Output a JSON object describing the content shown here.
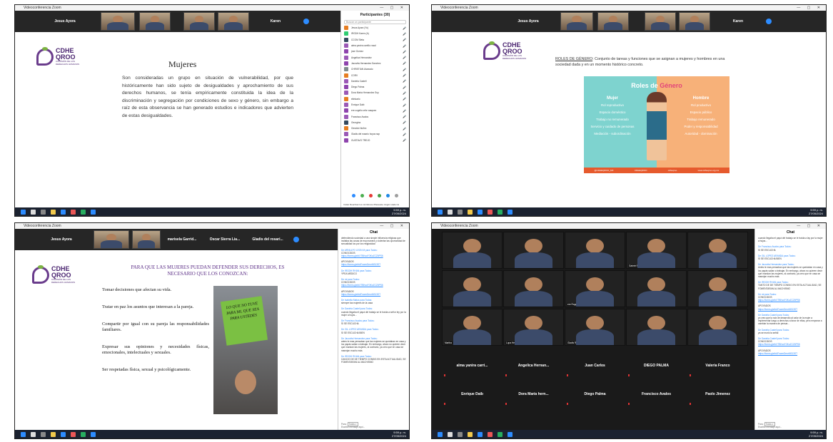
{
  "app": {
    "window_title": "Videoconferencia Zoom",
    "taskbar_clock": {
      "time": "9:59 p. m.",
      "date": "27/05/2024"
    }
  },
  "logo": {
    "name1": "CDHE",
    "name2": "QROO",
    "sub1": "COMISIÓN DE LOS",
    "sub2": "DERECHOS HUMANOS",
    "sub3": "DEL ESTADO DE QUINTANA ROO"
  },
  "screen1": {
    "strip_names": [
      "Jesus Ayora",
      "Karen"
    ],
    "slide_title": "Mujeres",
    "slide_body": "Son consideradas un grupo en situación de vulnerabilidad, por que históricamente han sido sujeto de desigualdades y aprochamiento de sus derechos humanos, se tenía empíricamente constituida la idea de la discriminación y segregación por condiciones de sexo y género, sin embargo a raíz de esta observancia se han generado estudios e indicadores que advierten de estas desigualdades.",
    "panel_title": "Participantes (30)",
    "search_placeholder": "Buscar un participante",
    "participants": [
      {
        "name": "Jesus Ayora (Yo)",
        "color": "#e67e22"
      },
      {
        "name": "IRGDH Karen (A)",
        "color": "#2ecc71"
      },
      {
        "name": "CCOM Sleta",
        "color": "#34495e"
      },
      {
        "name": "alma yanira carrillo rosal",
        "color": "#9b59b6"
      },
      {
        "name": "jose Gomez",
        "color": "#8e44ad"
      },
      {
        "name": "Angelica Hernandez",
        "color": "#9b59b6"
      },
      {
        "name": "Jacovita Hernandez Sanchez",
        "color": "#8e44ad"
      },
      {
        "name": "CHRISTIAN Alvarado",
        "color": "#7f8c8d"
      },
      {
        "name": "CORV",
        "color": "#e67e22"
      },
      {
        "name": "Daniela Castell",
        "color": "#9b59b6"
      },
      {
        "name": "Diego Palma",
        "color": "#8e44ad"
      },
      {
        "name": "Dora Maria Hernandez Ssp",
        "color": "#9b59b6"
      },
      {
        "name": "elielcarlo",
        "color": "#e67e22"
      },
      {
        "name": "Enrique Daib",
        "color": "#9b59b6"
      },
      {
        "name": "ere cogelio ortiz vasquez",
        "color": "#8e44ad"
      },
      {
        "name": "Francisco Avalos",
        "color": "#9b59b6"
      },
      {
        "name": "Georgina",
        "color": "#34495e"
      },
      {
        "name": "Geraldo Nuñez",
        "color": "#e67e22"
      },
      {
        "name": "Gladis del rosario hoyos ssp",
        "color": "#9b59b6"
      },
      {
        "name": "GUSTAVO TREJO",
        "color": "#8e44ad"
      }
    ],
    "panel_footer": "Invitar    Reactivar los micrófonos    Placeaste ningún viador ►"
  },
  "screen2": {
    "strip_names": [
      "Jesus Ayora",
      "Karen"
    ],
    "label": "ROLES DE GÉNERO",
    "definition": ": Conjunto de tareas y funciones que se asignan a mujeres y hombres en una sociedad dada y en un momento histórico concreto.",
    "infographic": {
      "title1": "Roles de",
      "title2": "Género",
      "mujer_head": "Mujer",
      "mujer_items": [
        "Rol reproductivo",
        "Espacio doméstico",
        "Trabajo no remunerado",
        "Servicio y cuidado de personas",
        "Mediación - subordinación"
      ],
      "hombre_head": "Hombre",
      "hombre_items": [
        "Rol productivo",
        "Espacio público",
        "Trabajo remunerado",
        "Poder y responsabilidad",
        "Autoridad - dominación"
      ],
      "footer": [
        "@CDHEQROO_MX",
        "CDHEQROO",
        "cdheqroo",
        "www.cdheqroo.org.mx"
      ]
    }
  },
  "screen3": {
    "strip_names": [
      "Jesus Ayora",
      "marisela Garrid...",
      "Oscar Sierra Lia...",
      "Gladis del rosari..."
    ],
    "heading": "PARA QUE LAS MUJERES PUEDAN DEFENDER SUS DERECHOS, ES NECESARIO QUE LOS CONOZCAN:",
    "items": [
      "Tomar decisiones que afectan su vida.",
      "Tratar en paz los asuntos que interesan a la pareja.",
      "Compartir por igual con su pareja las responsabilidades familiares.",
      "Expresar sus opiniones y necesidades físicas, emocionales, intelectuales y sexuales.",
      "Ser respetadas física, sexual y psicológicamente."
    ],
    "sign_text": "LO QUE NO TUVE PARA MI, QUE SEA PARA USTEDES",
    "chat_title": "Chat",
    "chat_messages": [
      {
        "from": "",
        "text": "defendiendo sociedad a una simple influencia religiosa que incitaba las cosas de esa manera y violentar las oportunidad de sexualidad los por los religiosidad"
      },
      {
        "from": "De ARNULFO LEON M para Todos:",
        "text": "CONOCIDOS",
        "link": "https://forms.gle/kXTBKsdY3KoZCZ6PS6"
      },
      {
        "from": "",
        "text": "APOYADOS",
        "link": "https://forms.gle/kAFnwmDenrMSJ3ST"
      },
      {
        "from": "De IRGDH RHAN para Todos:",
        "text": "YPEA MEDICO"
      },
      {
        "from": "De mi para Todos:",
        "text": "CONOCIDOS",
        "link": "https://forms.gle/kXTBKsdY3KoZCZ6PS6"
      },
      {
        "from": "",
        "text": "APOYADOS",
        "link": "https://forms.gle/kAFnwmDenrMSJ3ST"
      },
      {
        "from": "De Isabella Matus para Todos:",
        "text": "siempre las mujeres de la casa"
      },
      {
        "from": "De Daniela Castell para Todos:",
        "text": "cuando llegaba el papá del trabajo se le traída a señor ley por la mujer a hujos..."
      },
      {
        "from": "De Francisco Avalos para Todos:",
        "text": "SI SE ESCUCHA"
      },
      {
        "from": "De GIL LOPEZ ARANDA para Todos:",
        "text": "SI SE ESCUCHA BIEN"
      },
      {
        "from": "De Jacovita Hernandez para Todos:",
        "text": "antes te mas pensaban que las mujeres se quedaban en casa y los papás salían a trabajar. En embargo, ahora no quieren decir que mandan las mujeres, al contrario, ya creo que en casa se manejan mucho más"
      },
      {
        "from": "De IRGDH RHAN para Todos:",
        "text": "CANCIO DE DE TIEMPO CONSIG EN ESTA ACTUALIDAD, SE FOMENTARAN AL MACHISMO"
      }
    ],
    "chat_to_label": "Para:",
    "chat_to_value": "Todos ▾",
    "chat_input_placeholder": "Escribir mensaje aquí..."
  },
  "screen4": {
    "chat_title": "Chat",
    "tiles": [
      {
        "name": "",
        "row": 0,
        "col": 0
      },
      {
        "name": "",
        "row": 0,
        "col": 1
      },
      {
        "name": "",
        "row": 0,
        "col": 2
      },
      {
        "name": "Gabriel Nieto",
        "row": 0,
        "col": 3
      },
      {
        "name": "",
        "row": 0,
        "col": 4
      },
      {
        "name": "",
        "row": 1,
        "col": 0
      },
      {
        "name": "",
        "row": 1,
        "col": 1
      },
      {
        "name": "ere Rogelio ortiz vásquez",
        "row": 1,
        "col": 2
      },
      {
        "name": "",
        "row": 1,
        "col": 3
      },
      {
        "name": "",
        "row": 1,
        "col": 4
      },
      {
        "name": "Martha",
        "row": 2,
        "col": 0
      },
      {
        "name": "Lupa Hernandez",
        "row": 2,
        "col": 1
      },
      {
        "name": "Gladis Rosario Hoyos",
        "row": 2,
        "col": 2
      },
      {
        "name": "",
        "row": 2,
        "col": 3
      },
      {
        "name": "",
        "row": 2,
        "col": 4
      }
    ],
    "name_tiles_row1": [
      "alma yanira carri...",
      "Angelica Hernan...",
      "Juan Carlos",
      "DIEGO PALMA",
      "Valeria Franco"
    ],
    "name_tiles_row2": [
      "Enrique Daib",
      "Dora María hern...",
      "Diego Palma",
      "Francisco Avalos",
      "Paolo Jimenez"
    ],
    "chat_messages": [
      {
        "from": "",
        "text": "cuando llegaba el papá del trabajo se le traída a lay por la mujer a hujos..."
      },
      {
        "from": "De Francisco Avalos para Todos:",
        "text": "SI SE ESCUCHA"
      },
      {
        "from": "De GIL LOPEZ ARANDA para Todos:",
        "text": "SI SE ESCUCHA BIEN"
      },
      {
        "from": "De Jacovita Hernandez para Todos:",
        "text": "Antes te mas pensaban que las mujeres se quedaban en casa y los papás salían a trabajar. En embargo, ahora no quieren decir que mandan las mujeres, al contrario, ya creo que en casa se manejan mucho más"
      },
      {
        "from": "De IRGDH RHAN para Todos:",
        "text": "TANTO DE DE TIEMPO CONSIG EN ESTA ACTUALIDAD, SE FOMENTARAN AL MACHISMO"
      },
      {
        "from": "De mi para Todos:",
        "text": "CONOCIDOS",
        "link": "https://forms.gle/kXTBKsdY3KoZCZ6PS6"
      },
      {
        "from": "",
        "text": "APOYADOS",
        "link": "https://forms.gle/kAFnwmDenrMSJ3ST"
      },
      {
        "from": "De Daniela Castell para Todos:",
        "text": "yo creo que la raíz de desarrollo al valor de la mujer a implementar luego a derechos a favor de ellas, pero empezar a cambiar la manera de pensar..."
      },
      {
        "from": "De Daniela Castell para Todos:",
        "text": "ya se murió la señal"
      },
      {
        "from": "De Daniela Castell para Todos:",
        "text": "CONOCIDOS",
        "link": "https://forms.gle/kXTBKsdY3KoZCZ6PS6"
      },
      {
        "from": "",
        "text": "APOYADOS",
        "link": "https://forms.gle/kAFnwmDenrMSJ3ST"
      }
    ],
    "chat_to_label": "Para:",
    "chat_to_value": "Todos ▾",
    "chat_input_placeholder": "Escribir mensaje aquí..."
  }
}
